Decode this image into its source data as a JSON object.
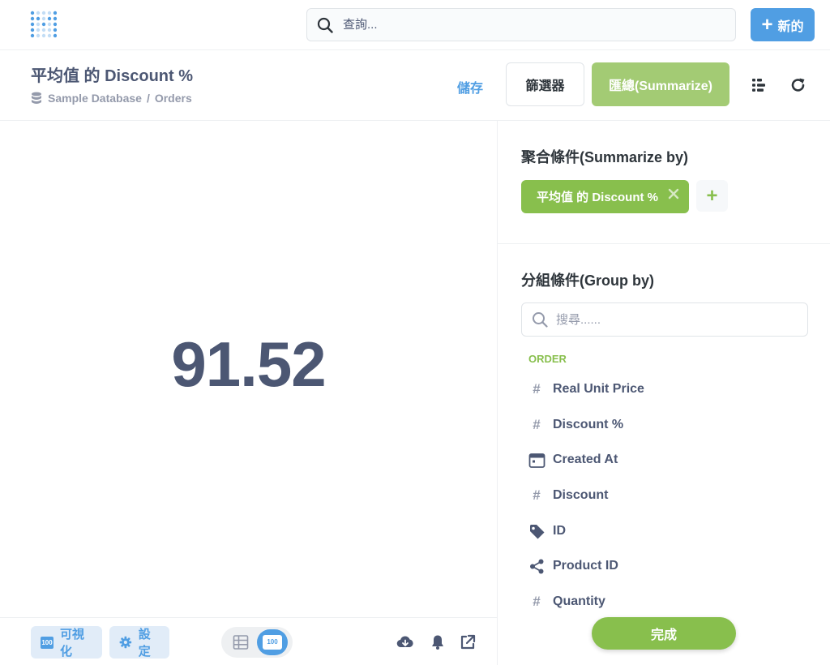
{
  "nav": {
    "search_placeholder": "查詢...",
    "new_label": "新的"
  },
  "header": {
    "title": "平均值 的 Discount %",
    "breadcrumb": {
      "database": "Sample Database",
      "separator": "/",
      "table": "Orders"
    },
    "save_label": "儲存",
    "filter_label": "篩選器",
    "summarize_label": "匯總(Summarize)"
  },
  "visualization": {
    "value": "91.52"
  },
  "footer": {
    "visualize_label": "可視化",
    "settings_label": "設定",
    "badge_text": "100"
  },
  "sidebar": {
    "summarize_title": "聚合條件(Summarize by)",
    "aggregation": "平均值 的 Discount %",
    "groupby_title": "分組條件(Group by)",
    "groupby_search_placeholder": "搜尋......",
    "table_name": "ORDER",
    "fields": [
      {
        "name": "Real Unit Price",
        "icon": "number-icon"
      },
      {
        "name": "Discount %",
        "icon": "number-icon"
      },
      {
        "name": "Created At",
        "icon": "calendar-icon"
      },
      {
        "name": "Discount",
        "icon": "number-icon"
      },
      {
        "name": "ID",
        "icon": "tag-icon"
      },
      {
        "name": "Product ID",
        "icon": "connections-icon"
      },
      {
        "name": "Quantity",
        "icon": "number-icon"
      }
    ],
    "done_label": "完成"
  },
  "colors": {
    "brand": "#509ee3",
    "summarize": "#88bf4d",
    "summarize_button": "#a3cb74",
    "text_dark": "#4c5773"
  }
}
